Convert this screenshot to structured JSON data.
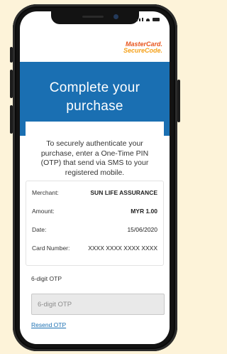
{
  "colors": {
    "background": "#fdf3d9",
    "primary": "#1a6fb2",
    "brand_orange": "#e8541c",
    "brand_yellow": "#f5a21c"
  },
  "logo": {
    "line1": "MasterCard.",
    "line2": "SecureCode."
  },
  "header": {
    "title": "Complete your purchase"
  },
  "intro": "To securely authenticate your purchase, enter a One-Time PIN (OTP) that send via SMS to your registered mobile.",
  "details": [
    {
      "label": "Merchant:",
      "value": "SUN LIFE ASSURANCE"
    },
    {
      "label": "Amount:",
      "value": "MYR 1.00"
    },
    {
      "label": "Date:",
      "value": "15/06/2020"
    },
    {
      "label": "Card Number:",
      "value": "XXXX XXXX XXXX XXXX"
    }
  ],
  "otp": {
    "label": "6-digit OTP",
    "placeholder": "6-digit OTP",
    "value": ""
  },
  "resend_label": "Resend OTP"
}
